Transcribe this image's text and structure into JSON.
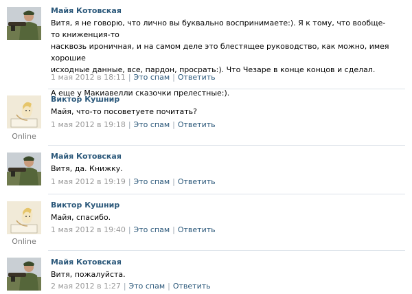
{
  "comments": [
    {
      "author": "Майя Котовская",
      "text_lines": [
        "Витя, я не говорю, что лично вы буквально воспринимаете:). Я к тому, что вообще-то книженция-то",
        "насквозь ироничная, и на самом деле это блестящее руководство, как можно, имея хорошие",
        "исходные данные, все, пардон, просрать:). Что Чезаре в конце концов и сделал.",
        "",
        "А еще у Макиавелли сказочки прелестные:)."
      ],
      "date": "1 мая 2012 в 18:11",
      "spam_label": "Это спам",
      "reply_label": "Ответить",
      "online": ""
    },
    {
      "author": "Виктор Кушнир",
      "text_lines": [
        "Майя, что-то посоветуете почитать?"
      ],
      "date": "1 мая 2012 в 19:18",
      "spam_label": "Это спам",
      "reply_label": "Ответить",
      "online": "Online"
    },
    {
      "author": "Майя Котовская",
      "text_lines": [
        "Витя, да. Книжку."
      ],
      "date": "1 мая 2012 в 19:19",
      "spam_label": "Это спам",
      "reply_label": "Ответить",
      "online": ""
    },
    {
      "author": "Виктор Кушнир",
      "text_lines": [
        "Майя, спасибо."
      ],
      "date": "1 мая 2012 в 19:40",
      "spam_label": "Это спам",
      "reply_label": "Ответить",
      "online": "Online"
    },
    {
      "author": "Майя Котовская",
      "text_lines": [
        "Витя, пожалуйста."
      ],
      "date": "2 мая 2012 в 1:27",
      "spam_label": "Это спам",
      "reply_label": "Ответить",
      "online": ""
    }
  ],
  "colors": {
    "link": "#2b587a",
    "meta": "#999999",
    "divider": "#dae1e8"
  }
}
